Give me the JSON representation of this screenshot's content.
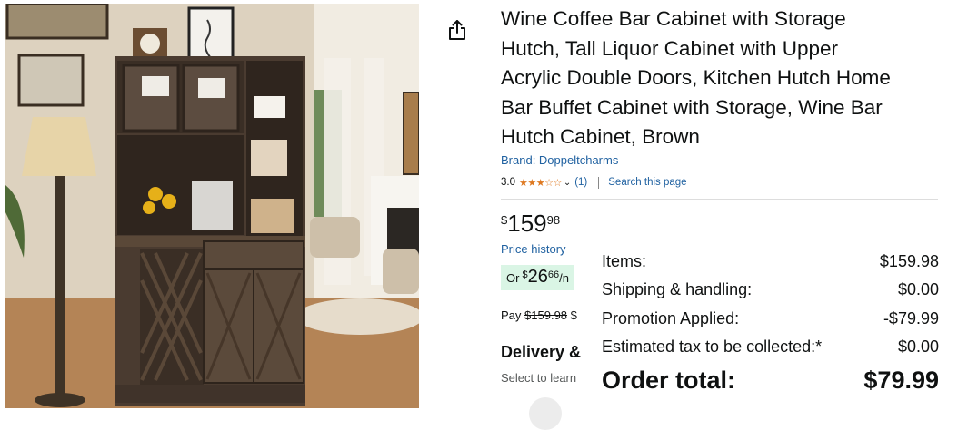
{
  "product": {
    "title_lines": [
      "Wine Coffee Bar Cabinet with Storage",
      "Hutch, Tall Liquor Cabinet with Upper",
      "Acrylic Double Doors, Kitchen Hutch Home",
      "Bar Buffet Cabinet with Storage, Wine Bar",
      "Hutch Cabinet, Brown"
    ],
    "brand": "Brand: Doppeltcharms",
    "rating": "3.0",
    "rating_stars": 3,
    "stars_text": "★★★☆☆",
    "review_count": "(1)",
    "search_page": "Search this page"
  },
  "price": {
    "currency": "$",
    "whole": "159",
    "fraction": "98"
  },
  "price_history": "Price history",
  "monthly": {
    "or": "Or",
    "currency": "$",
    "whole": "26",
    "fraction": "66",
    "per": "/n"
  },
  "pay": {
    "label": "Pay",
    "strike": "$159.98",
    "trail": "$"
  },
  "delivery": {
    "title": "Delivery &",
    "subtitle": "Select to learn"
  },
  "summary": {
    "rows": [
      {
        "label": "Items:",
        "value": "$159.98"
      },
      {
        "label": "Shipping & handling:",
        "value": "$0.00"
      },
      {
        "label": "Promotion Applied:",
        "value": "-$79.99"
      },
      {
        "label": "Estimated tax to be collected:*",
        "value": "$0.00"
      }
    ],
    "total_label": "Order total:",
    "total_value": "$79.99"
  },
  "colors": {
    "link": "#2162a1",
    "star": "#de7921",
    "monthly_bg": "#daf5e5",
    "text": "#0f1111",
    "cabinet": "#4a3b30"
  },
  "icons": [
    "share-icon",
    "chevron-down-icon"
  ]
}
